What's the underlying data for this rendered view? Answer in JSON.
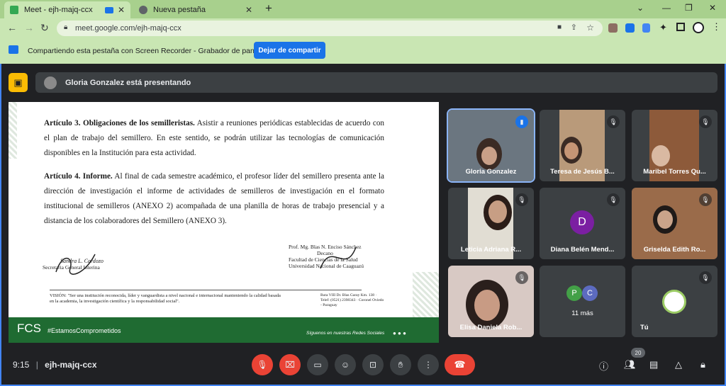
{
  "browser": {
    "tabs": [
      {
        "title": "Meet - ejh-majq-ccx"
      },
      {
        "title": "Nueva pestaña"
      }
    ],
    "new_tab": "+",
    "url": "meet.google.com/ejh-majq-ccx"
  },
  "share_banner": {
    "text": "Compartiendo esta pestaña con Screen Recorder - Grabador de pantalla",
    "button": "Dejar de compartir"
  },
  "presenter_bar": {
    "text": "Gloria Gonzalez está presentando"
  },
  "slide": {
    "art3_title": "Artículo 3. Obligaciones de los semilleristas.",
    "art3_body": " Asistir a reuniones periódicas establecidas de acuerdo con el plan de trabajo del semillero. En este sentido, se podrán utilizar las tecnologías de comunicación disponibles en la Institución para esta actividad.",
    "art4_title": "Artículo 4. Informe.",
    "art4_body": " Al final de cada semestre académico, el profesor líder del semillero presenta ante la dirección de investigación el informe de actividades de semilleros de investigación en el formato institucional de semilleros (ANEXO 2) acompañada de una planilla de horas de trabajo presencial y a distancia de los colaboradores del Semillero (ANEXO 3).",
    "sig_left_name": "Sandra L. Cardozo",
    "sig_left_role": "Secretaria General Interina",
    "sig_right_name": "Prof. Mg. Blas N. Enciso Sánchez",
    "sig_right_role1": "Decano",
    "sig_right_role2": "Facultad de Ciencias de la Salud",
    "sig_right_role3": "Universidad Nacional de Caaguazú",
    "vision": "VISIÓN: \"Ser una institución reconocida, líder y vanguardista a nivel nacional e internacional manteniendo la calidad basada en la academia, la investigación científica y la responsabilidad social\".",
    "contact": "Ruta VIII Dr. Blas Garay Km. 138 · Telef: (0521) 2398343 · Coronel Oviedo - Paraguay",
    "brand": "FCS",
    "hashtag": "#EstamosComprometidos",
    "social": "Síguenos en nuestras Redes Sociales"
  },
  "participants": [
    {
      "name": "Gloria Gonzalez",
      "speaking": true
    },
    {
      "name": "Teresa de Jesús B..."
    },
    {
      "name": "Maribel Torres Qu..."
    },
    {
      "name": "Leticia Adriana R..."
    },
    {
      "name": "Diana Belén Mend...",
      "initial": "D"
    },
    {
      "name": "Griselda Edith Ro..."
    },
    {
      "name": "Elisa Daniela Rob..."
    },
    {
      "name": "11 más",
      "initials": [
        "P",
        "C"
      ]
    },
    {
      "name": "Tú"
    }
  ],
  "bottom_bar": {
    "time": "9:15",
    "separator": "|",
    "meeting_code": "ejh-majq-ccx",
    "participant_count": "20"
  },
  "colors": {
    "accent": "#1a73e8",
    "danger": "#ea4335",
    "chrome_green": "#a8d08d",
    "slide_green": "#1f6b32"
  }
}
